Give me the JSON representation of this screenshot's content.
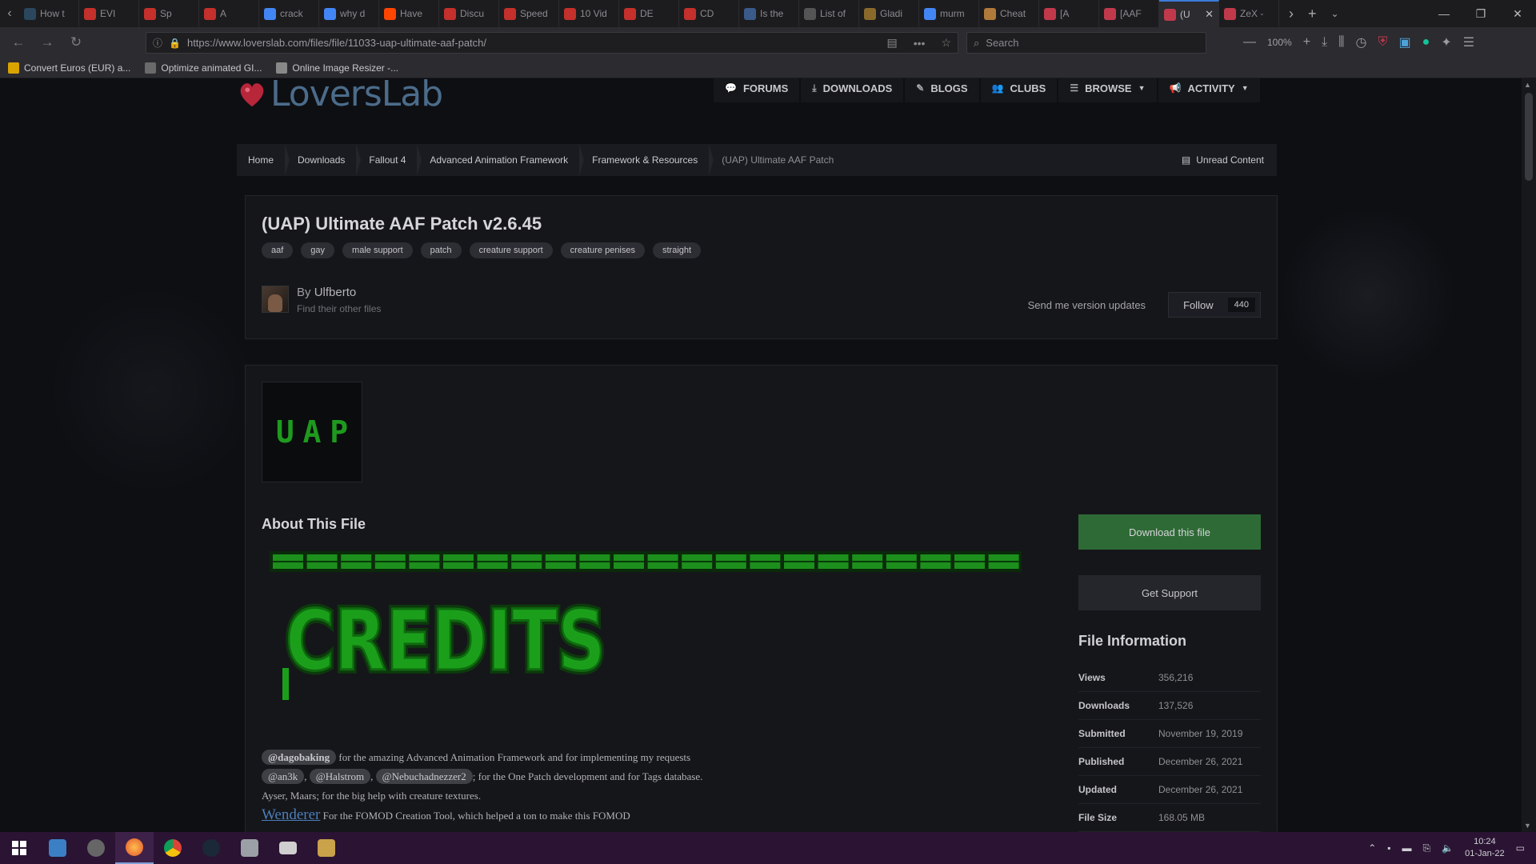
{
  "browser": {
    "tabs": [
      {
        "title": "How t",
        "favicon": "steam-icon",
        "color": "#2a475e"
      },
      {
        "title": "EVI",
        "favicon": "youtube-icon",
        "color": "#c4302b"
      },
      {
        "title": "Sp",
        "favicon": "youtube-icon",
        "color": "#c4302b"
      },
      {
        "title": "A",
        "favicon": "youtube-icon",
        "color": "#c4302b"
      },
      {
        "title": "crack",
        "favicon": "google-icon",
        "color": "#4285f4"
      },
      {
        "title": "why d",
        "favicon": "google-icon",
        "color": "#4285f4"
      },
      {
        "title": "Have",
        "favicon": "reddit-icon",
        "color": "#ff4500"
      },
      {
        "title": "Discu",
        "favicon": "youtube-icon",
        "color": "#c4302b"
      },
      {
        "title": "Speed",
        "favicon": "youtube-icon",
        "color": "#c4302b"
      },
      {
        "title": "10 Vid",
        "favicon": "youtube-icon",
        "color": "#c4302b"
      },
      {
        "title": "DE",
        "favicon": "youtube-icon",
        "color": "#c4302b"
      },
      {
        "title": "CD",
        "favicon": "youtube-icon",
        "color": "#c4302b"
      },
      {
        "title": "Is the",
        "favicon": "site-icon",
        "color": "#3a5a8a"
      },
      {
        "title": "List of",
        "favicon": "wikipedia-icon",
        "color": "#555555"
      },
      {
        "title": "Gladi",
        "favicon": "site-icon",
        "color": "#8a6a2a"
      },
      {
        "title": "murm",
        "favicon": "google-icon",
        "color": "#4285f4"
      },
      {
        "title": "Cheat",
        "favicon": "site-icon",
        "color": "#b07a3a"
      },
      {
        "title": "[A",
        "favicon": "loverslab-icon",
        "color": "#c0394b"
      },
      {
        "title": "[AAF",
        "favicon": "loverslab-icon",
        "color": "#c0394b"
      },
      {
        "title": "(U",
        "favicon": "loverslab-icon",
        "color": "#c0394b",
        "active": true
      },
      {
        "title": "ZeX -",
        "favicon": "loverslab-icon",
        "color": "#c0394b"
      }
    ],
    "url": "https://www.loverslab.com/files/file/11033-uap-ultimate-aaf-patch/",
    "search_placeholder": "Search",
    "zoom": "100%",
    "bookmarks": [
      {
        "label": "Convert Euros (EUR) a...",
        "color": "#d9a400"
      },
      {
        "label": "Optimize animated GI...",
        "color": "#6a6a6a"
      },
      {
        "label": "Online Image Resizer -...",
        "color": "#888888"
      }
    ]
  },
  "site": {
    "logo_text": "LoversLab",
    "nav": [
      {
        "label": "FORUMS",
        "icon": "comments-icon"
      },
      {
        "label": "DOWNLOADS",
        "icon": "download-icon"
      },
      {
        "label": "BLOGS",
        "icon": "blog-icon"
      },
      {
        "label": "CLUBS",
        "icon": "users-icon"
      },
      {
        "label": "BROWSE",
        "icon": "list-icon",
        "dropdown": true
      },
      {
        "label": "ACTIVITY",
        "icon": "megaphone-icon",
        "dropdown": true
      }
    ],
    "breadcrumb": [
      "Home",
      "Downloads",
      "Fallout 4",
      "Advanced Animation Framework",
      "Framework & Resources",
      "(UAP) Ultimate AAF Patch"
    ],
    "unread_label": "Unread Content"
  },
  "file": {
    "title": "(UAP) Ultimate AAF Patch v2.6.45",
    "tags": [
      "aaf",
      "gay",
      "male support",
      "patch",
      "creature support",
      "creature penises",
      "straight"
    ],
    "author_by": "By",
    "author_name": "Ulfberto",
    "author_sub": "Find their other files",
    "follow_text": "Send me version updates",
    "follow_label": "Follow",
    "follow_count": "440",
    "thumb_letters": [
      "U",
      "A",
      "P"
    ],
    "about_title": "About This File",
    "credits_heading": "CREDITS",
    "credits": {
      "line1_mention": "@dagobaking",
      "line1_text": "for the amazing Advanced Animation Framework and for implementing my requests",
      "line2_mentions": [
        "@an3k",
        "@Halstrom",
        "@Nebuchadnezzer2"
      ],
      "line2_text": "; for the One Patch development and for Tags database.",
      "line3_text": "Ayser, Maars; for the big help with creature textures.",
      "line4_link": "Wenderer",
      "line4_text": "For the FOMOD Creation Tool, which helped a ton to make this FOMOD"
    }
  },
  "sidebar": {
    "download_label": "Download this file",
    "support_label": "Get Support",
    "info_title": "File Information",
    "info": [
      {
        "key": "Views",
        "value": "356,216"
      },
      {
        "key": "Downloads",
        "value": "137,526"
      },
      {
        "key": "Submitted",
        "value": "November 19, 2019"
      },
      {
        "key": "Published",
        "value": "December 26, 2021"
      },
      {
        "key": "Updated",
        "value": "December 26, 2021"
      },
      {
        "key": "File Size",
        "value": "168.05 MB"
      }
    ]
  },
  "taskbar": {
    "time": "10:24",
    "date": "01-Jan-22"
  }
}
